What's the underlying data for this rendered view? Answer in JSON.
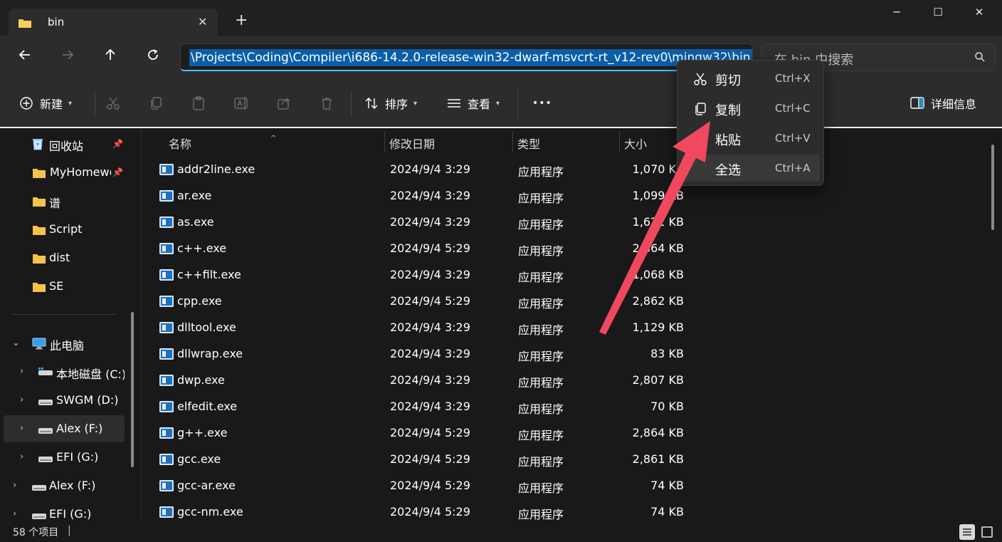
{
  "tab": {
    "title": "bin",
    "close": "✕",
    "new": "+"
  },
  "window": {
    "minimize": "─",
    "maximize": "☐",
    "close": "✕"
  },
  "address": {
    "path": "\\Projects\\Coding\\Compiler\\i686-14.2.0-release-win32-dwarf-msvcrt-rt_v12-rev0\\mingw32\\bin",
    "search_placeholder": "在 bin 中搜索"
  },
  "toolbar": {
    "new_label": "新建",
    "sort_label": "排序",
    "view_label": "查看",
    "more": "•••",
    "details_label": "详细信息"
  },
  "sidebar": {
    "pinned": [
      {
        "label": "回收站",
        "icon": "recycle-bin-icon"
      },
      {
        "label": "MyHomework",
        "icon": "folder-icon"
      },
      {
        "label": "谱",
        "icon": "folder-icon"
      },
      {
        "label": "Script",
        "icon": "folder-icon"
      },
      {
        "label": "dist",
        "icon": "folder-icon"
      },
      {
        "label": "SE",
        "icon": "folder-icon"
      }
    ],
    "this_pc": "此电脑",
    "drives": [
      {
        "label": "本地磁盘 (C:)"
      },
      {
        "label": "SWGM (D:)"
      },
      {
        "label": "Alex (F:)"
      },
      {
        "label": "EFI (G:)"
      }
    ],
    "extra": [
      {
        "label": "Alex (F:)"
      },
      {
        "label": "EFI (G:)"
      }
    ]
  },
  "columns": {
    "name": "名称",
    "date": "修改日期",
    "type": "类型",
    "size": "大小"
  },
  "files": [
    {
      "name": "addr2line.exe",
      "date": "2024/9/4 3:29",
      "type": "应用程序",
      "size": "1,070 KB"
    },
    {
      "name": "ar.exe",
      "date": "2024/9/4 3:29",
      "type": "应用程序",
      "size": "1,099 KB"
    },
    {
      "name": "as.exe",
      "date": "2024/9/4 3:29",
      "type": "应用程序",
      "size": "1,621 KB"
    },
    {
      "name": "c++.exe",
      "date": "2024/9/4 5:29",
      "type": "应用程序",
      "size": "2,864 KB"
    },
    {
      "name": "c++filt.exe",
      "date": "2024/9/4 3:29",
      "type": "应用程序",
      "size": "1,068 KB"
    },
    {
      "name": "cpp.exe",
      "date": "2024/9/4 5:29",
      "type": "应用程序",
      "size": "2,862 KB"
    },
    {
      "name": "dlltool.exe",
      "date": "2024/9/4 3:29",
      "type": "应用程序",
      "size": "1,129 KB"
    },
    {
      "name": "dllwrap.exe",
      "date": "2024/9/4 3:29",
      "type": "应用程序",
      "size": "83 KB"
    },
    {
      "name": "dwp.exe",
      "date": "2024/9/4 3:29",
      "type": "应用程序",
      "size": "2,807 KB"
    },
    {
      "name": "elfedit.exe",
      "date": "2024/9/4 3:29",
      "type": "应用程序",
      "size": "70 KB"
    },
    {
      "name": "g++.exe",
      "date": "2024/9/4 5:29",
      "type": "应用程序",
      "size": "2,864 KB"
    },
    {
      "name": "gcc.exe",
      "date": "2024/9/4 5:29",
      "type": "应用程序",
      "size": "2,861 KB"
    },
    {
      "name": "gcc-ar.exe",
      "date": "2024/9/4 5:29",
      "type": "应用程序",
      "size": "74 KB"
    },
    {
      "name": "gcc-nm.exe",
      "date": "2024/9/4 5:29",
      "type": "应用程序",
      "size": "74 KB"
    }
  ],
  "status": {
    "count": "58 个项目",
    "sep": "|"
  },
  "context_menu": [
    {
      "label": "剪切",
      "shortcut": "Ctrl+X",
      "icon": "scissors-icon"
    },
    {
      "label": "复制",
      "shortcut": "Ctrl+C",
      "icon": "copy-icon"
    },
    {
      "label": "粘贴",
      "shortcut": "Ctrl+V",
      "icon": "paste-icon"
    },
    {
      "label": "全选",
      "shortcut": "Ctrl+A",
      "icon": "select-all-icon"
    }
  ],
  "colors": {
    "accent": "#4cc2ff",
    "selection": "#0a5ea8",
    "annotation_arrow": "#f0485e",
    "folder": "#f5c34a"
  }
}
